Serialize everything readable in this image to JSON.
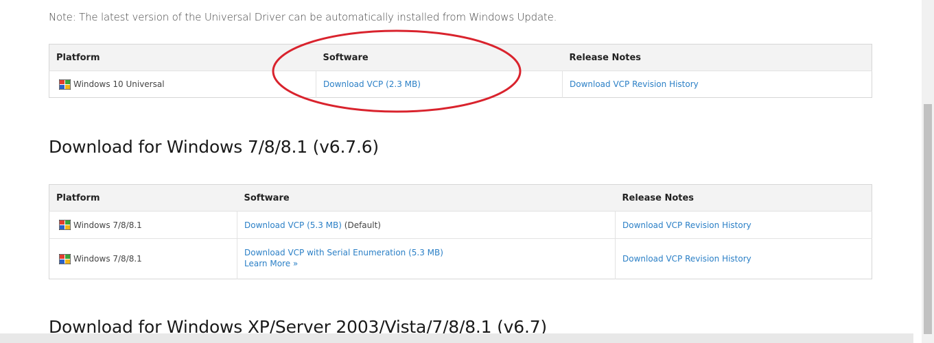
{
  "note": "Note: The latest version of the Universal Driver can be automatically installed from Windows Update.",
  "headers": {
    "platform": "Platform",
    "software": "Software",
    "release_notes": "Release Notes"
  },
  "table1": {
    "rows": [
      {
        "platform": "Windows 10 Universal",
        "software_link": "Download VCP (2.3 MB)",
        "notes_link": "Download VCP Revision History"
      }
    ]
  },
  "section_win7": {
    "title": "Download for Windows 7/8/8.1 (v6.7.6)"
  },
  "table2": {
    "rows": [
      {
        "platform": "Windows 7/8/8.1",
        "software_link": "Download VCP (5.3 MB)",
        "software_suffix": " (Default)",
        "notes_link": "Download VCP Revision History"
      },
      {
        "platform": "Windows 7/8/8.1",
        "software_link": "Download VCP with Serial Enumeration (5.3 MB)",
        "learn_more": "Learn More »",
        "notes_link": "Download VCP Revision History"
      }
    ]
  },
  "section_xp": {
    "title": "Download for Windows XP/Server 2003/Vista/7/8/8.1 (v6.7)"
  },
  "annotation": {
    "ellipse_color": "#d9232d"
  },
  "colors": {
    "link": "#2a7fc6",
    "header_bg": "#f3f3f3"
  },
  "icons": {
    "platform": "windows-logo-icon"
  }
}
